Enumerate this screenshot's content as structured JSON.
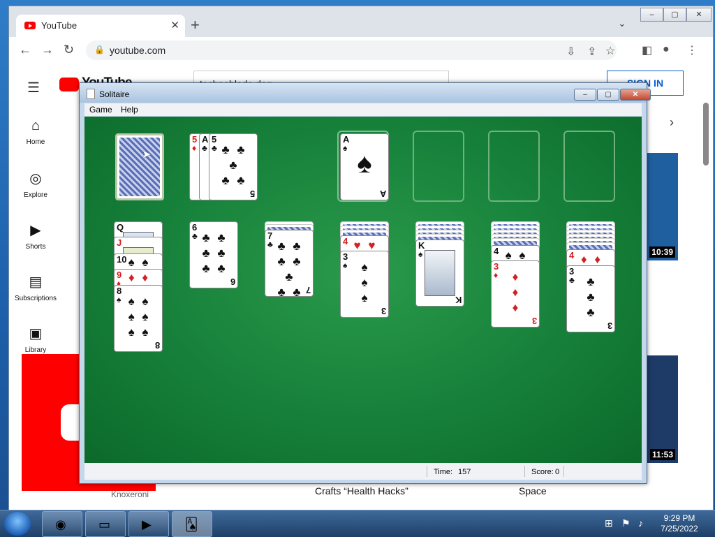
{
  "browser": {
    "tab_title": "YouTube",
    "tab_close": "✕",
    "new_tab": "+",
    "url": "youtube.com",
    "window_controls": [
      "–",
      "▢",
      "✕"
    ]
  },
  "youtube": {
    "logo_text": "YouTube",
    "search_value": "technoblade dog",
    "sign_in": "SIGN IN",
    "sidebar": [
      {
        "icon": "home-icon",
        "label": "Home"
      },
      {
        "icon": "explore-icon",
        "label": "Explore"
      },
      {
        "icon": "shorts-icon",
        "label": "Shorts"
      },
      {
        "icon": "subscriptions-icon",
        "label": "Subscriptions"
      },
      {
        "icon": "library-icon",
        "label": "Library"
      }
    ],
    "durations": [
      "10:39",
      "11:53"
    ],
    "bottom_texts": [
      "Knoxeroni",
      "Crafts “Health Hacks”",
      "Space"
    ]
  },
  "solitaire": {
    "title": "Solitaire",
    "menu": [
      "Game",
      "Help"
    ],
    "time_label": "Time:",
    "time_value": "157",
    "score_label": "Score:",
    "score_value": "0",
    "waste": [
      {
        "rank": "5",
        "suit": "♦",
        "color": "red"
      },
      {
        "rank": "A",
        "suit": "♣",
        "color": "blk"
      },
      {
        "rank": "5",
        "suit": "♣",
        "color": "blk"
      }
    ],
    "foundation": [
      {
        "rank": "A",
        "suit": "♠",
        "color": "blk"
      }
    ],
    "tableau": [
      {
        "visible": [
          {
            "rank": "Q",
            "suit": "♠",
            "color": "blk"
          },
          {
            "rank": "J",
            "suit": "♦",
            "color": "red"
          },
          {
            "rank": "10",
            "suit": "♠",
            "color": "blk"
          },
          {
            "rank": "9",
            "suit": "♦",
            "color": "red"
          },
          {
            "rank": "8",
            "suit": "♠",
            "color": "blk"
          }
        ]
      },
      {
        "visible": [
          {
            "rank": "6",
            "suit": "♣",
            "color": "blk"
          }
        ]
      },
      {
        "visible": [
          {
            "rank": "7",
            "suit": "♣",
            "color": "blk"
          }
        ]
      },
      {
        "visible": [
          {
            "rank": "4",
            "suit": "♥",
            "color": "red"
          },
          {
            "rank": "3",
            "suit": "♠",
            "color": "blk"
          }
        ]
      },
      {
        "visible": [
          {
            "rank": "K",
            "suit": "♠",
            "color": "blk"
          }
        ]
      },
      {
        "visible": [
          {
            "rank": "4",
            "suit": "♠",
            "color": "blk"
          },
          {
            "rank": "3",
            "suit": "♦",
            "color": "red"
          }
        ]
      },
      {
        "visible": [
          {
            "rank": "4",
            "suit": "♦",
            "color": "red"
          },
          {
            "rank": "3",
            "suit": "♣",
            "color": "blk"
          }
        ]
      }
    ]
  },
  "taskbar": {
    "apps": [
      "chrome-icon",
      "explorer-icon",
      "media-player-icon",
      "solitaire-icon"
    ],
    "time": "9:29 PM",
    "date": "7/25/2022"
  }
}
